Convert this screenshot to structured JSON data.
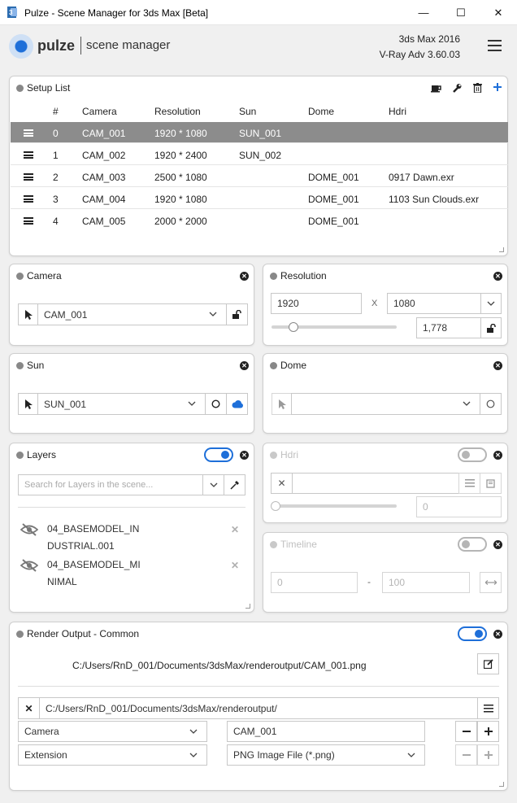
{
  "window": {
    "title": "Pulze - Scene Manager for 3ds Max [Beta]",
    "minimize": "—",
    "maximize": "☐",
    "close": "✕"
  },
  "header": {
    "logo": "pulze",
    "subtitle": "scene manager",
    "app_version": "3ds Max 2016",
    "renderer": "V-Ray Adv 3.60.03",
    "menu_icon": "hamburger-icon"
  },
  "setup_list": {
    "title": "Setup List",
    "columns": [
      "#",
      "Camera",
      "Resolution",
      "Sun",
      "Dome",
      "Hdri"
    ],
    "rows": [
      {
        "num": "0",
        "camera": "CAM_001",
        "resolution": "1920 * 1080",
        "sun": "SUN_001",
        "dome": "",
        "hdri": "",
        "selected": true
      },
      {
        "num": "1",
        "camera": "CAM_002",
        "resolution": "1920 * 2400",
        "sun": "SUN_002",
        "dome": "",
        "hdri": ""
      },
      {
        "num": "2",
        "camera": "CAM_003",
        "resolution": "2500 * 1080",
        "sun": "",
        "dome": "DOME_001",
        "hdri": "0917 Dawn.exr"
      },
      {
        "num": "3",
        "camera": "CAM_004",
        "resolution": "1920 * 1080",
        "sun": "",
        "dome": "DOME_001",
        "hdri": "1103 Sun Clouds.exr"
      },
      {
        "num": "4",
        "camera": "CAM_005",
        "resolution": "2000 * 2000",
        "sun": "",
        "dome": "DOME_001",
        "hdri": ""
      }
    ],
    "toolbar_icons": [
      "coffee-icon",
      "wrench-icon",
      "trash-icon",
      "plus-icon"
    ]
  },
  "camera": {
    "title": "Camera",
    "value": "CAM_001"
  },
  "resolution": {
    "title": "Resolution",
    "width": "1920",
    "height": "1080",
    "separator": "X",
    "ratio": "1,778",
    "slider_level": 0.1
  },
  "sun": {
    "title": "Sun",
    "value": "SUN_001"
  },
  "dome": {
    "title": "Dome",
    "value": ""
  },
  "layers": {
    "title": "Layers",
    "enabled": true,
    "search_placeholder": "Search for Layers in the scene...",
    "items": [
      {
        "line1": "04_BASEMODEL_IN",
        "line2": "DUSTRIAL.001"
      },
      {
        "line1": "04_BASEMODEL_MI",
        "line2": "NIMAL"
      }
    ]
  },
  "hdri": {
    "title": "Hdri",
    "enabled": false,
    "path": "",
    "value": "0",
    "slider_level": 0
  },
  "timeline": {
    "title": "Timeline",
    "enabled": false,
    "start": "0",
    "end": "100",
    "separator": "-"
  },
  "render_output": {
    "title": "Render Output - Common",
    "enabled": true,
    "full_path": "C:/Users/RnD_001/Documents/3dsMax/renderoutput/CAM_001.png",
    "folder": "C:/Users/RnD_001/Documents/3dsMax/renderoutput/",
    "token1_type": "Camera",
    "token1_value": "CAM_001",
    "token2_type": "Extension",
    "token2_value": "PNG Image File (*.png)"
  }
}
